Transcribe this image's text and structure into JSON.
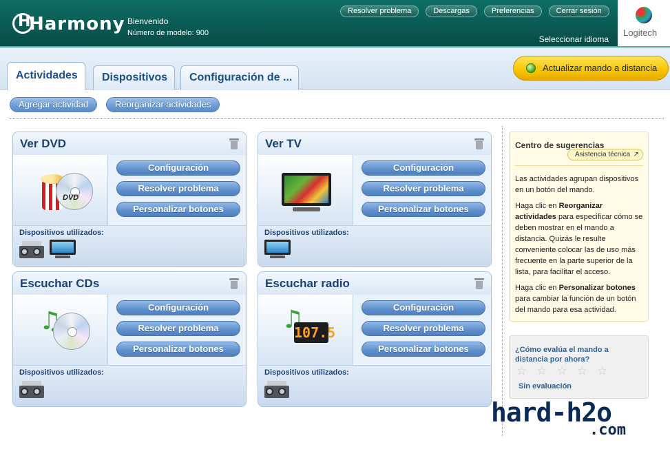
{
  "header": {
    "logo": "Harmony",
    "welcome": "Bienvenido",
    "model": "Número de modelo: 900",
    "links": [
      "Resolver problema",
      "Descargas",
      "Preferencias",
      "Cerrar sesión"
    ],
    "language": "Seleccionar idioma",
    "brand": "Logitech"
  },
  "tabs": [
    "Actividades",
    "Dispositivos",
    "Configuración de ..."
  ],
  "update_button": "Actualizar mando a distancia",
  "actions": {
    "add": "Agregar actividad",
    "reorder": "Reorganizar actividades"
  },
  "card_buttons": [
    "Configuración",
    "Resolver problema",
    "Personalizar botones"
  ],
  "devices_label": "Dispositivos utilizados:",
  "activities": [
    {
      "title": "Ver DVD",
      "devices": [
        "stereo-icon",
        "tv-icon"
      ]
    },
    {
      "title": "Ver TV",
      "devices": [
        "tv-icon"
      ]
    },
    {
      "title": "Escuchar CDs",
      "devices": [
        "stereo-icon"
      ]
    },
    {
      "title": "Escuchar radio",
      "devices": [
        "stereo-icon"
      ]
    }
  ],
  "radio_display": "107.5",
  "dvd_label": "DVD",
  "suggestions": {
    "title": "Centro de sugerencias",
    "help": "Asistencia técnica",
    "p1": "Las actividades agrupan dispositivos en un botón del mando.",
    "p2_a": "Haga clic en ",
    "p2_b": "Reorganizar actividades",
    "p2_c": " para especificar cómo se deben mostrar en el mando a distancia. Quizás le resulte conveniente colocar las de uso más frecuente en la parte superior de la lista, para facilitar el acceso.",
    "p3_a": "Haga clic en ",
    "p3_b": "Personalizar botones",
    "p3_c": " para cambiar la función de un botón del mando para esa actividad."
  },
  "rating": {
    "question": "¿Cómo evalúa el mando a distancia por ahora?",
    "stars": 5,
    "value": 0,
    "none": "Sin evaluación"
  },
  "watermark": {
    "line1": "hard-h2o",
    "line2": ".com"
  },
  "colors": {
    "header": "#0a5a54",
    "accent_blue": "#5f8fcb",
    "update_yellow": "#f7c400",
    "title_blue": "#1d4272"
  }
}
